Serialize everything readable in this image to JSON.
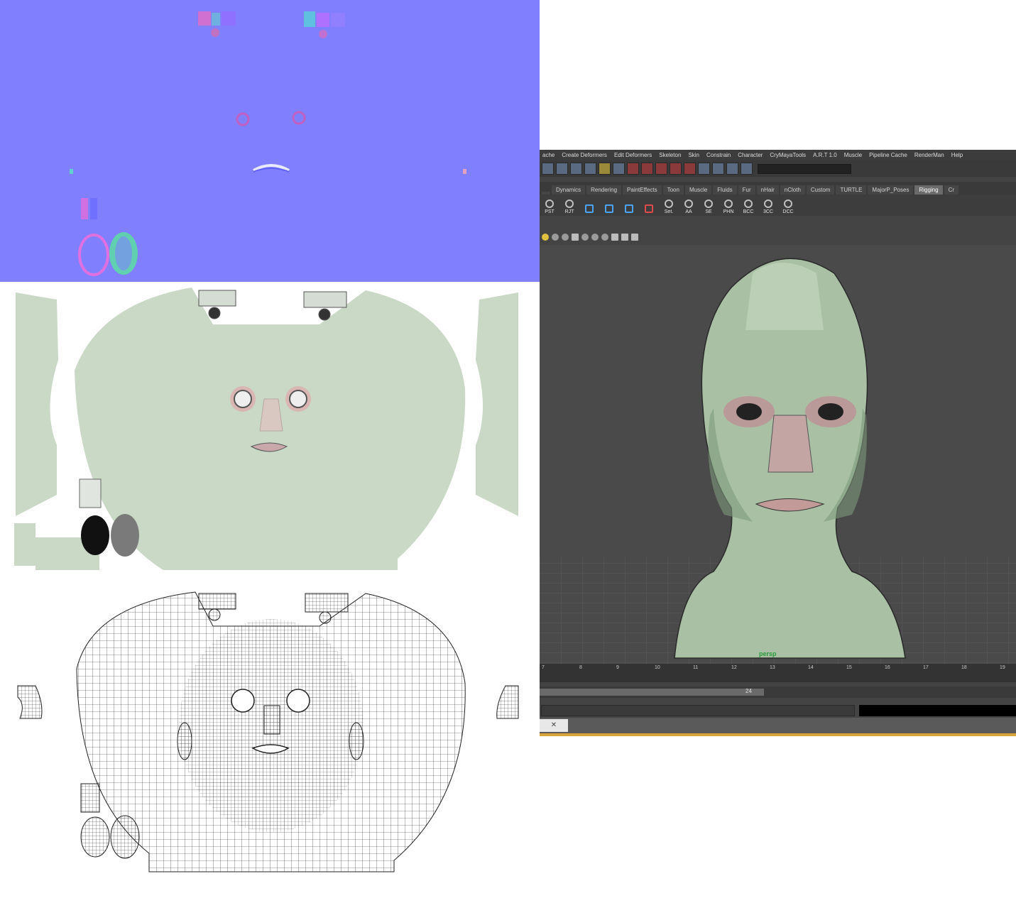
{
  "maya": {
    "menu": [
      "ache",
      "Create Deformers",
      "Edit Deformers",
      "Skeleton",
      "Skin",
      "Constrain",
      "Character",
      "CryMayaTools",
      "A.R.T 1.0",
      "Muscle",
      "Pipeline Cache",
      "RenderMan",
      "Help"
    ],
    "shelf_tabs": [
      "",
      "Dynamics",
      "Rendering",
      "PaintEffects",
      "Toon",
      "Muscle",
      "Fluids",
      "Fur",
      "nHair",
      "nCloth",
      "Custom",
      "TURTLE",
      "MajorP_Poses",
      "Rigging",
      "Cr"
    ],
    "active_shelf_tab": "Rigging",
    "shelf_buttons": [
      "PST",
      "RJT",
      "",
      "",
      "",
      "",
      "Set.",
      "AA",
      "SE",
      "PHN",
      "BCC",
      "3CC",
      "DCC"
    ],
    "camera_label": "persp",
    "timeline_ticks": [
      "7",
      "8",
      "9",
      "10",
      "11",
      "12",
      "13",
      "14",
      "15",
      "16",
      "17",
      "18",
      "19"
    ],
    "range_end_value": "24",
    "close_symbol": "✕"
  },
  "colors": {
    "normal_map_bg": "#8080ff",
    "diffuse_skin": "#c9d9c5",
    "maya_bg": "#444444",
    "active_tab": "#6b6b6b",
    "camera_label": "#2a9a3a",
    "bottom_strip": "#d9a53a"
  }
}
